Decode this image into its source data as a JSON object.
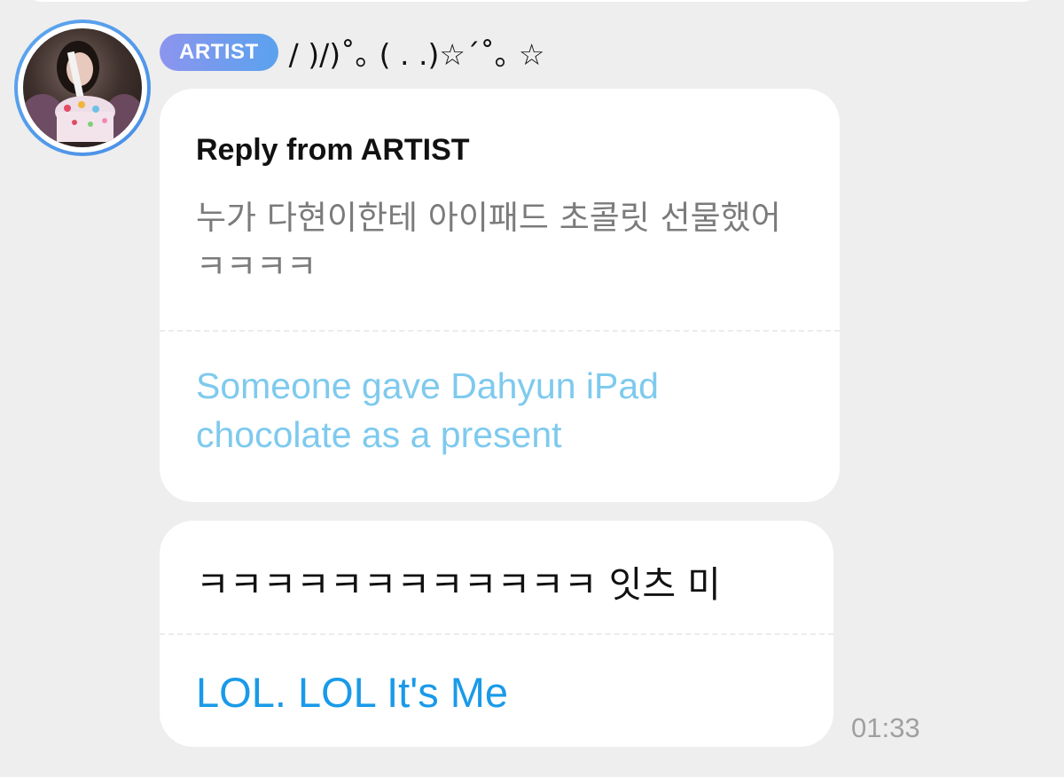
{
  "sender": {
    "badge": "ARTIST",
    "display_name": "/ )/)˚｡ ( . .)☆´˚｡ ☆",
    "avatar_icon": "artist-avatar-photo",
    "avatar_ring_color": "#4a8ee6"
  },
  "messages": [
    {
      "reply_header": "Reply from ARTIST",
      "original": "누가 다현이한테 아이패드 초콜릿 선물했어ㅋㅋㅋㅋ",
      "translation": "Someone gave Dahyun iPad chocolate as a present"
    },
    {
      "original": "ㅋㅋㅋㅋㅋㅋㅋㅋㅋㅋㅋㅋ 잇츠 미",
      "translation": "LOL. LOL It's Me",
      "time": "01:33"
    }
  ],
  "colors": {
    "background": "#eeeeee",
    "bubble": "#ffffff",
    "badge_gradient_start": "#8c95ee",
    "badge_gradient_end": "#5aa2ee",
    "reply_translation": "#7ecaee",
    "translation": "#1a9ae8",
    "muted_text": "#7b7b7b",
    "timestamp": "#a0a0a0"
  }
}
